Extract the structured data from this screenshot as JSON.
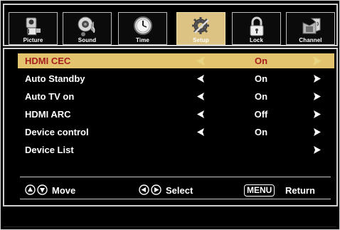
{
  "tabs": [
    {
      "label": "Picture",
      "icon": "camera-icon"
    },
    {
      "label": "Sound",
      "icon": "sound-icon"
    },
    {
      "label": "Time",
      "icon": "clock-icon"
    },
    {
      "label": "Setup",
      "icon": "setup-gear-icon",
      "selected": true
    },
    {
      "label": "Lock",
      "icon": "lock-icon"
    },
    {
      "label": "Channel",
      "icon": "channel-tv-icon"
    }
  ],
  "settings": [
    {
      "label": "HDMI CEC",
      "value": "On",
      "highlighted": true
    },
    {
      "label": "Auto Standby",
      "value": "On"
    },
    {
      "label": "Auto TV on",
      "value": "On"
    },
    {
      "label": "HDMI ARC",
      "value": "Off"
    },
    {
      "label": "Device control",
      "value": "On"
    },
    {
      "label": "Device List",
      "value": ""
    }
  ],
  "footer": {
    "move": "Move",
    "select": "Select",
    "menu_key": "MENU",
    "return": "Return"
  },
  "colors": {
    "highlight_bg": "#e3c36d",
    "highlight_text": "#a51e1e",
    "selected_tab": "#dcc384"
  }
}
